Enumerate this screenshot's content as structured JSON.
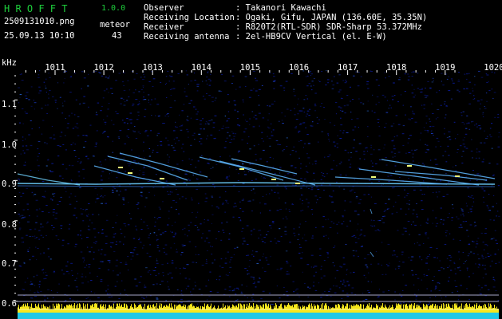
{
  "app": {
    "logo": "H R O F F T",
    "version": "1.0.0"
  },
  "file": {
    "name": "2509131010.png",
    "datetime": "25.09.13 10:10"
  },
  "counter": {
    "label": "meteor",
    "value": "43"
  },
  "info": {
    "observer_key": "Observer",
    "observer_val": ": Takanori Kawachi",
    "location_key": "Receiving Location",
    "location_val": ": Ogaki, Gifu, JAPAN (136.60E, 35.35N)",
    "receiver_key": "Receiver",
    "receiver_val": ": R820T2(RTL-SDR) SDR-Sharp 53.372MHz",
    "antenna_key": "Receiving antenna",
    "antenna_val": ": 2el-HB9CV Vertical (el. E-W)"
  },
  "axis": {
    "y_unit": "kHz",
    "x_ticks": [
      "1011",
      "1012",
      "1013",
      "1014",
      "1015",
      "1016",
      "1017",
      "1018",
      "1019",
      "1020"
    ],
    "y_ticks": [
      "1.1",
      "1.0",
      "0.9",
      "0.8",
      "0.7",
      "0.6"
    ]
  },
  "colors": {
    "background": "#000000",
    "noise": "#0c1c9e",
    "carrier": "#6fd2ff",
    "meteor": "#f4ff7a",
    "level_fill": "#1ec8e6",
    "level_peak": "#f6e61a",
    "guide": "#a9a9c8"
  }
}
